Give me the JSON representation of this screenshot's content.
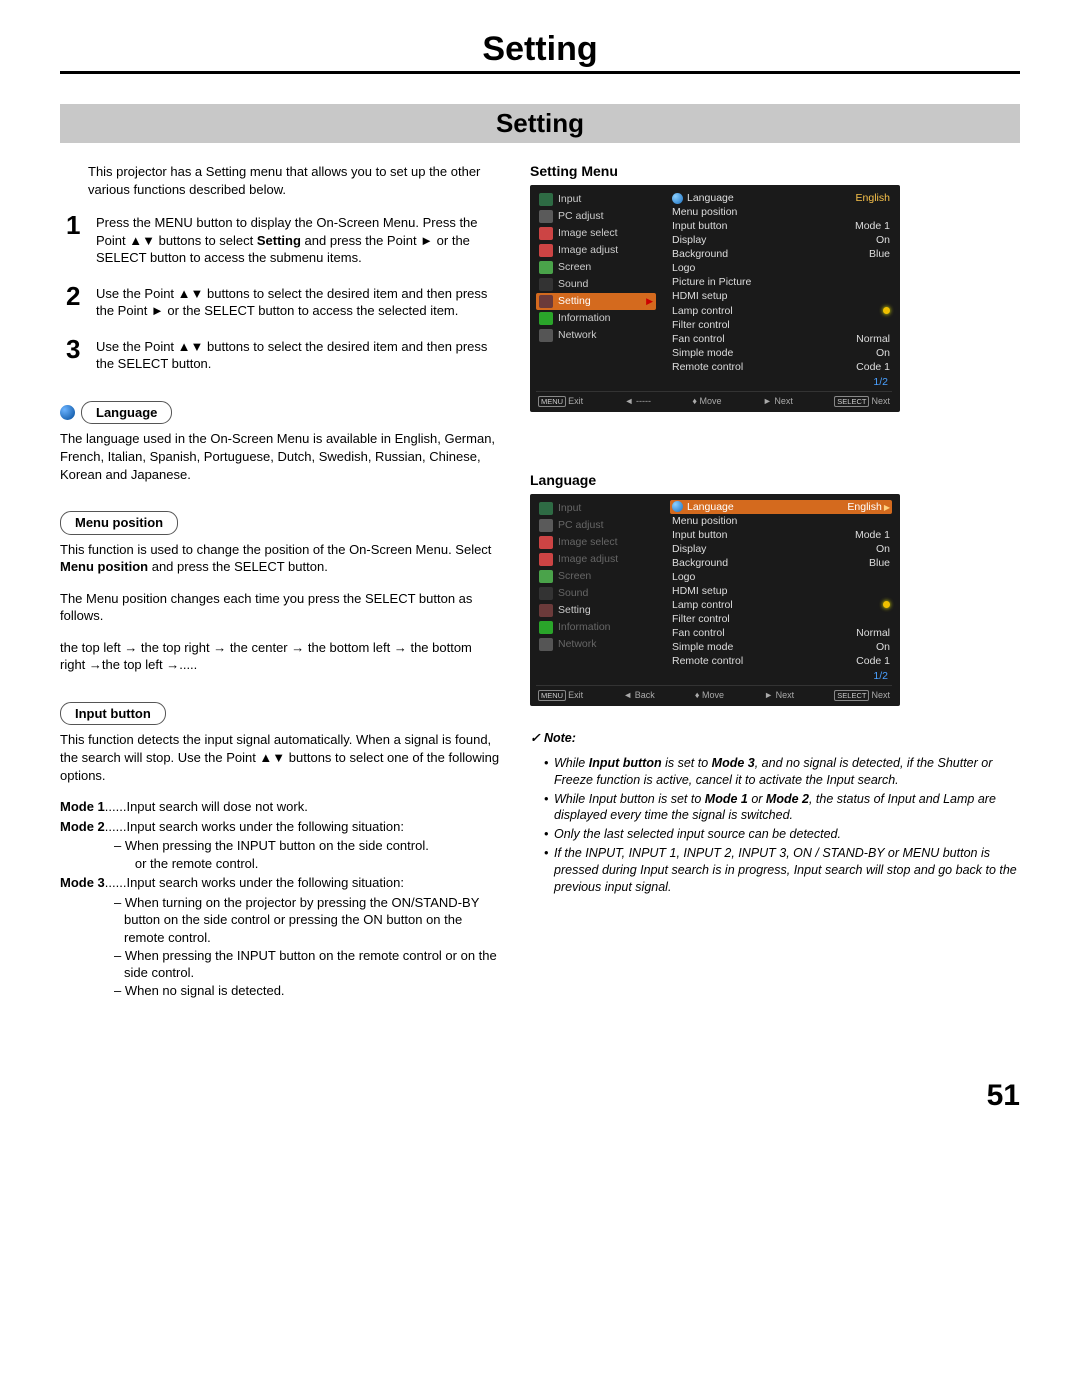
{
  "title": "Setting",
  "section_title": "Setting",
  "intro": "This projector has a Setting menu that allows you to set up the other various functions described below.",
  "steps": [
    {
      "n": "1",
      "text": "Press the MENU button to display the On-Screen Menu. Press the Point ▲▼ buttons to select Setting and press the Point ► or the SELECT button to access the submenu items.",
      "bold": "Setting"
    },
    {
      "n": "2",
      "text": "Use the Point ▲▼ buttons to select the desired item and then press the Point ► or the SELECT button to access the selected item."
    },
    {
      "n": "3",
      "text": "Use the Point ▲▼ buttons to select the desired item and then press the SELECT button."
    }
  ],
  "lang_pill": "Language",
  "lang_para": "The language used in the On-Screen Menu is available in English, German, French, Italian, Spanish, Portuguese, Dutch, Swedish, Russian, Chinese, Korean and Japanese.",
  "menpos_pill": "Menu position",
  "menpos_para1": "This function is used to change the position of the On-Screen Menu. Select Menu position and press the SELECT button.",
  "menpos_bold": "Menu position",
  "menpos_para2": "The Menu position changes each time you press the SELECT button as follows.",
  "menpos_flow": "the top left  →  the top right  →  the center → the bottom left → the bottom right  →the top left  →.....",
  "input_pill": "Input button",
  "input_para": "This function detects the input signal automatically. When a signal is found, the search will stop. Use the Point ▲▼ buttons to select one of the following options.",
  "modes": {
    "m1_label": "Mode 1",
    "m1_text": "......Input search will dose not work.",
    "m2_label": "Mode 2",
    "m2_text": "......Input search works under the following situation:",
    "m2_sub1": "– When pressing the INPUT button on the side control or the remote control.",
    "m2_sub1a": "   or the remote control.",
    "m3_label": "Mode 3",
    "m3_text": "......Input search works under the following situation:",
    "m3_sub1": "– When turning on the projector by pressing the ON/STAND-BY button on the side control or pressing the ON button on the remote control.",
    "m3_sub2": "– When pressing the INPUT button on the remote control or on the side control.",
    "m3_sub3": "– When no signal is detected."
  },
  "right": {
    "setting_menu_heading": "Setting Menu",
    "language_heading": "Language",
    "nav": [
      "Input",
      "PC adjust",
      "Image select",
      "Image adjust",
      "Screen",
      "Sound",
      "Setting",
      "Information",
      "Network"
    ],
    "settings_list": [
      {
        "k": "Language",
        "v": "English"
      },
      {
        "k": "Menu position",
        "v": ""
      },
      {
        "k": "Input button",
        "v": "Mode 1"
      },
      {
        "k": "Display",
        "v": "On"
      },
      {
        "k": "Background",
        "v": "Blue"
      },
      {
        "k": "Logo",
        "v": ""
      },
      {
        "k": "Picture in Picture",
        "v": ""
      },
      {
        "k": "HDMI setup",
        "v": ""
      },
      {
        "k": "Lamp control",
        "v": "",
        "lamp": true
      },
      {
        "k": "Filter control",
        "v": ""
      },
      {
        "k": "Fan control",
        "v": "Normal"
      },
      {
        "k": "Simple mode",
        "v": "On"
      },
      {
        "k": "Remote control",
        "v": "Code 1"
      }
    ],
    "page_indicator": "1/2",
    "footer1": {
      "exit": "Exit",
      "back": "-----",
      "move": "Move",
      "next": "Next",
      "select": "Next"
    },
    "footer2": {
      "exit": "Exit",
      "back": "Back",
      "move": "Move",
      "next": "Next",
      "select": "Next"
    }
  },
  "note": {
    "head": "✓ Note:",
    "items": [
      "While Input button is set to Mode 3, and no signal is detected, if the Shutter or Freeze function is active, cancel it to activate the Input search.",
      "While Input button is set to Mode 1 or Mode 2, the status of Input and Lamp are displayed every time the signal is switched.",
      "Only the last selected input source can be detected.",
      "If the INPUT, INPUT 1, INPUT 2, INPUT 3, ON / STAND-BY or MENU button is pressed during Input search is in progress, Input search will stop and go back to the previous input signal."
    ]
  },
  "page_number": "51"
}
